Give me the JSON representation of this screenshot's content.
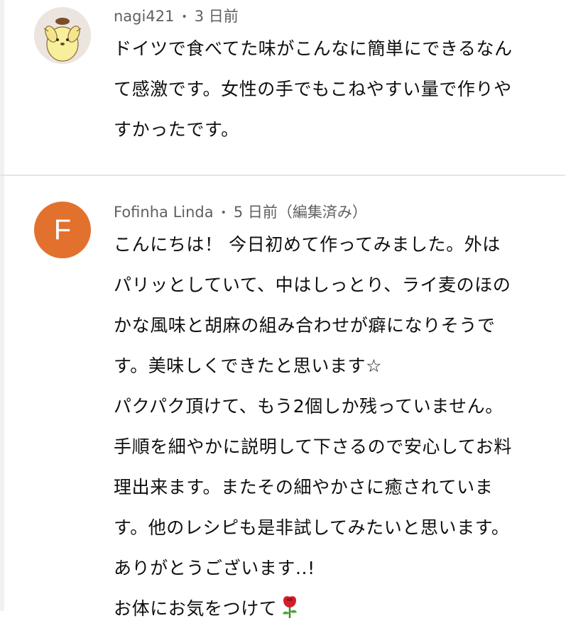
{
  "comments": [
    {
      "author": "nagi421",
      "separator": "•",
      "time": "3 日前",
      "avatar_icon": "pompompurin-avatar-icon",
      "lines": [
        "ドイツで食べてた味がこんなに簡単にできるなん",
        "て感激です。女性の手でもこねやすい量で作りや",
        "すかったです。"
      ]
    },
    {
      "author": "Fofinha Linda",
      "separator": "•",
      "time": "5 日前（編集済み）",
      "avatar_letter": "F",
      "avatar_color": "#e2712e",
      "lines": [
        "こんにちは！ 今日初めて作ってみました。外は",
        "パリッとしていて、中はしっとり、ライ麦のほの",
        "かな風味と胡麻の組み合わせが癖になりそうで",
        "す。美味しくできたと思います☆",
        "パクパク頂けて、もう2個しか残っていません。",
        "手順を細やかに説明して下さるので安心してお料",
        "理出来ます。またその細やかさに癒されていま",
        "す。他のレシピも是非試してみたいと思います。",
        "ありがとうございます..!",
        "お体にお気をつけて"
      ],
      "trailing_icon": "rose-icon"
    }
  ]
}
